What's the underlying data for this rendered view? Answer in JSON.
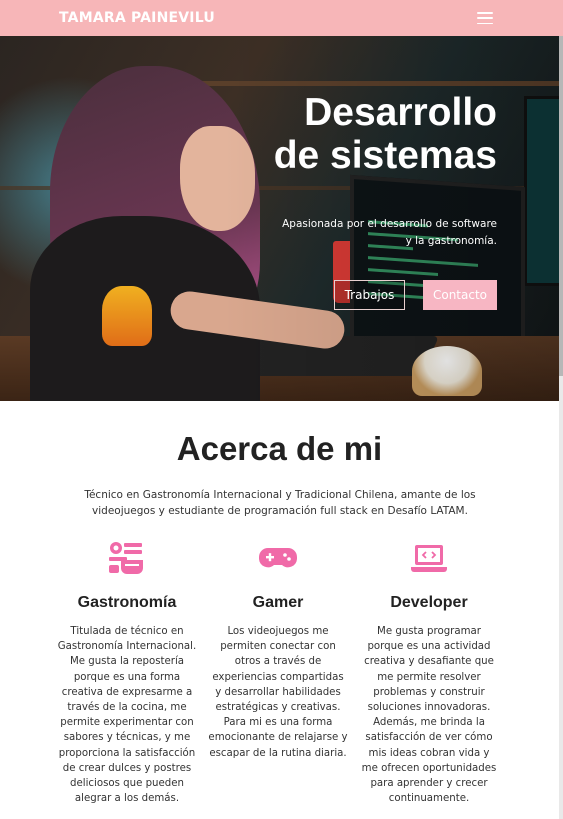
{
  "nav": {
    "brand": "TAMARA PAINEVILU",
    "menu_icon": "hamburger-menu-icon"
  },
  "hero": {
    "title_line1": "Desarrollo",
    "title_line2": "de sistemas",
    "subtitle": "Apasionada por el desarrollo de software y la gastronomía.",
    "buttons": {
      "primary_label": "Trabajos",
      "secondary_label": "Contacto"
    }
  },
  "about": {
    "title": "Acerca de mi",
    "text": "Técnico en Gastronomía Internacional y Tradicional Chilena, amante de los videojuegos y estudiante de programación full stack en Desafío LATAM.",
    "columns": [
      {
        "icon": "chef-hat-food-icon",
        "title": "Gastronomía",
        "text": "Titulada de técnico en Gastronomía Internacional. Me gusta la repostería porque es una forma creativa de expresarme a través de la cocina, me permite experimentar con sabores y técnicas, y me proporciona la satisfacción de crear dulces y postres deliciosos que pueden alegrar a los demás."
      },
      {
        "icon": "gamepad-icon",
        "title": "Gamer",
        "text": "Los videojuegos me permiten conectar con otros a través de experiencias compartidas y desarrollar habilidades estratégicas y creativas. Para mi es una forma emocionante de relajarse y escapar de la rutina diaria."
      },
      {
        "icon": "laptop-code-icon",
        "title": "Developer",
        "text": "Me gusta programar porque es una actividad creativa y desafiante que me permite resolver problemas y construir soluciones innovadoras. Además, me brinda la satisfacción de ver cómo mis ideas cobran vida y me ofrecen oportunidades para aprender y crecer continuamente."
      }
    ]
  },
  "colors": {
    "accent": "#f7b6b8",
    "button_pink": "#f7b6c3",
    "icon_pink": "#f06aa8"
  }
}
